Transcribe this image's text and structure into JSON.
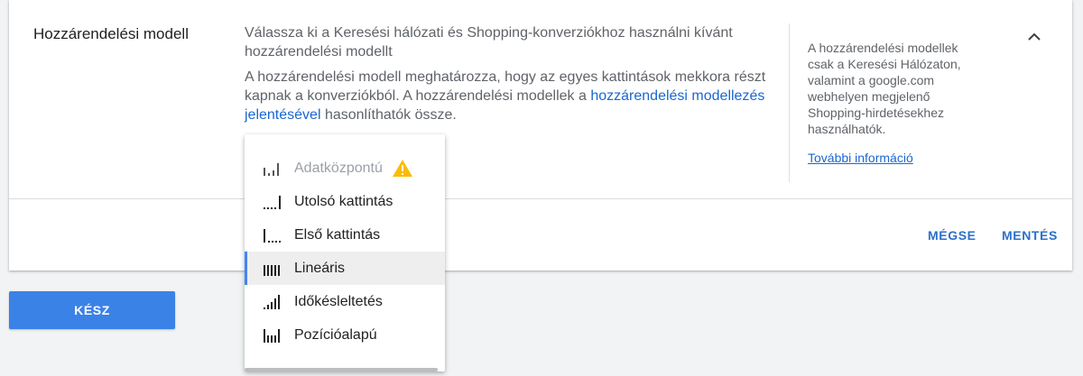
{
  "section": {
    "title": "Hozzárendelési modell",
    "description_1": "Válassza ki a Keresési hálózati és Shopping-konverziókhoz használni kívánt hozzárendelési modellt",
    "description_2_before": "A hozzárendelési modell meghatározza, hogy az egyes kattintások mekkora részt kapnak a konverziókból. A hozzárendelési modellek a ",
    "description_2_link": "hozzárendelési modellezés jelentésével",
    "description_2_after": " hasonlíthatók össze.",
    "side_note": "A hozzárendelési modellek csak a Keresési Hálózaton, valamint a google.com webhelyen megjelenő Shopping-hirdetésekhez használhatók.",
    "side_link": "További információ"
  },
  "actions": {
    "cancel": "MÉGSE",
    "save": "MENTÉS",
    "done": "KÉSZ"
  },
  "dropdown": {
    "options": [
      {
        "label": "Adatközpontú",
        "icon": "data-driven-icon",
        "disabled": true,
        "warning": true
      },
      {
        "label": "Utolsó kattintás",
        "icon": "last-click-icon"
      },
      {
        "label": "Első kattintás",
        "icon": "first-click-icon"
      },
      {
        "label": "Lineáris",
        "icon": "linear-icon",
        "selected": true
      },
      {
        "label": "Időkésleltetés",
        "icon": "time-decay-icon"
      },
      {
        "label": "Pozícióalapú",
        "icon": "position-based-icon"
      }
    ]
  },
  "colors": {
    "accent": "#1a73e8",
    "link": "#1967d2",
    "warning": "#fbbc04",
    "selected_indicator": "#4285f4"
  }
}
